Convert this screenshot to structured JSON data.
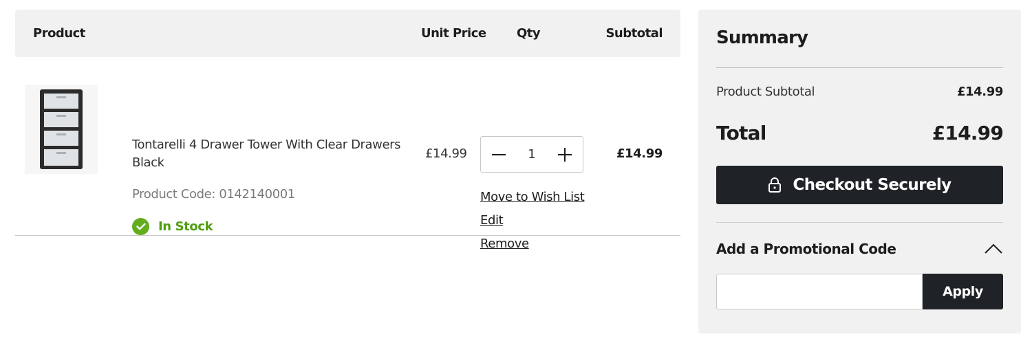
{
  "cart": {
    "headers": {
      "product": "Product",
      "unit_price": "Unit Price",
      "qty": "Qty",
      "subtotal": "Subtotal"
    },
    "item": {
      "name": "Tontarelli 4 Drawer Tower With Clear Drawers Black",
      "product_code": "Product Code: 0142140001",
      "stock_status": "In Stock",
      "unit_price": "£14.99",
      "quantity": "1",
      "subtotal": "£14.99",
      "image_icon": "drawer-tower-image",
      "actions": {
        "wish_list": "Move to Wish List",
        "edit": "Edit",
        "remove": "Remove"
      }
    }
  },
  "summary": {
    "title": "Summary",
    "product_subtotal_label": "Product Subtotal",
    "product_subtotal_value": "£14.99",
    "total_label": "Total",
    "total_value": "£14.99",
    "checkout_label": "Checkout Securely",
    "promo_title": "Add a Promotional Code",
    "promo_placeholder": "",
    "promo_apply": "Apply"
  },
  "colors": {
    "panel_bg": "#f0f1f0",
    "dark_button": "#1f2226",
    "in_stock_green": "#62ad1d"
  }
}
